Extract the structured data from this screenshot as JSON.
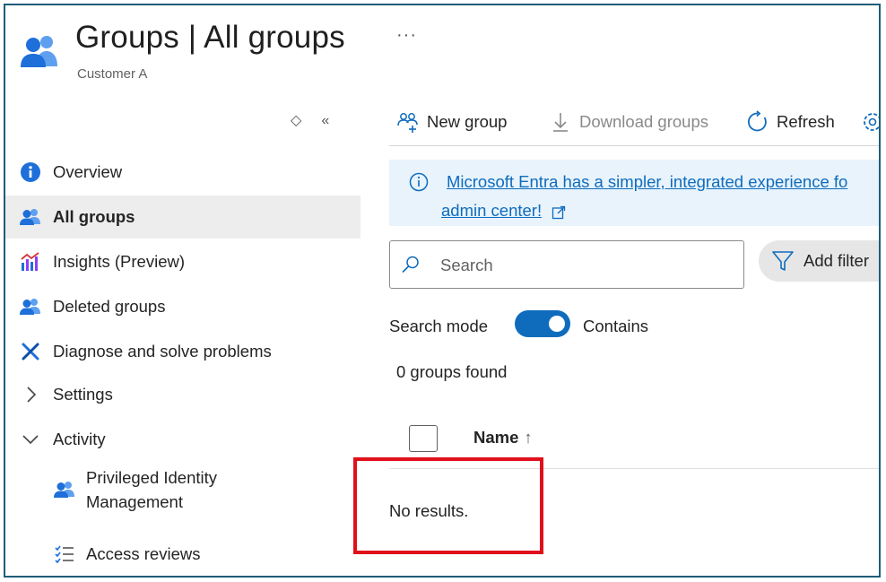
{
  "header": {
    "title": "Groups | All groups",
    "subtitle": "Customer A",
    "more_icon": "ellipsis-icon"
  },
  "sidebar": {
    "collapse_icons": [
      "sort-updown-icon",
      "double-chevron-left-icon"
    ],
    "items": [
      {
        "label": "Overview",
        "icon": "info-circle-icon",
        "active": false
      },
      {
        "label": "All groups",
        "icon": "groups-icon",
        "active": true
      },
      {
        "label": "Insights (Preview)",
        "icon": "insights-chart-icon",
        "active": false
      },
      {
        "label": "Deleted groups",
        "icon": "groups-icon",
        "active": false
      },
      {
        "label": "Diagnose and solve problems",
        "icon": "tools-cross-icon",
        "active": false
      },
      {
        "label": "Settings",
        "icon": "chevron-right-icon",
        "active": false
      },
      {
        "label": "Activity",
        "icon": "chevron-down-icon",
        "active": false
      },
      {
        "label": "Privileged Identity Management",
        "label_line1": "Privileged Identity",
        "label_line2": "Management",
        "icon": "groups-icon",
        "active": false
      },
      {
        "label": "Access reviews",
        "icon": "checklist-icon",
        "active": false
      }
    ]
  },
  "toolbar": {
    "new_group": "New group",
    "download_groups": "Download groups",
    "refresh": "Refresh"
  },
  "banner": {
    "line1": "Microsoft Entra has a simpler, integrated experience fo",
    "line2": "admin center!"
  },
  "search": {
    "placeholder": "Search",
    "value": ""
  },
  "filter": {
    "label": "Add filter"
  },
  "search_mode": {
    "label": "Search mode",
    "toggle_on": true,
    "value": "Contains"
  },
  "results": {
    "count_text": "0 groups found",
    "column_name": "Name",
    "sort_indicator": "↑",
    "empty_text": "No results."
  },
  "colors": {
    "accent": "#0f6cbd",
    "active_bg": "#ededed",
    "banner_bg": "#e8f3fc",
    "highlight_border": "#e0101a",
    "frame_border": "#1d5d7a"
  }
}
